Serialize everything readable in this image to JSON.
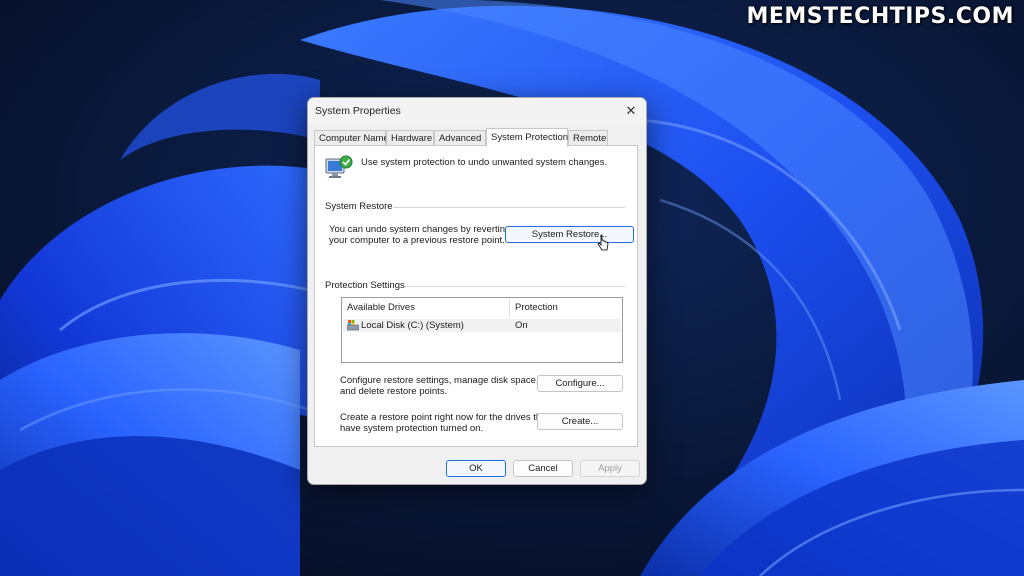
{
  "watermark": "MEMSTECHTIPS.COM",
  "dialog": {
    "title": "System Properties",
    "tabs": [
      {
        "label": "Computer Name",
        "active": false
      },
      {
        "label": "Hardware",
        "active": false
      },
      {
        "label": "Advanced",
        "active": false
      },
      {
        "label": "System Protection",
        "active": true
      },
      {
        "label": "Remote",
        "active": false
      }
    ],
    "intro_text": "Use system protection to undo unwanted system changes.",
    "system_restore": {
      "group_label": "System Restore",
      "description_line1": "You can undo system changes by reverting",
      "description_line2": "your computer to a previous restore point.",
      "button_label": "System Restore..."
    },
    "protection_settings": {
      "group_label": "Protection Settings",
      "columns": [
        "Available Drives",
        "Protection"
      ],
      "drives": [
        {
          "name": "Local Disk (C:) (System)",
          "protection": "On"
        }
      ],
      "configure_text_line1": "Configure restore settings, manage disk space,",
      "configure_text_line2": "and delete restore points.",
      "configure_button": "Configure...",
      "create_text_line1": "Create a restore point right now for the drives that",
      "create_text_line2": "have system protection turned on.",
      "create_button": "Create..."
    },
    "footer": {
      "ok": "OK",
      "cancel": "Cancel",
      "apply": "Apply"
    }
  },
  "colors": {
    "accent": "#1e6fd9",
    "wallpaper_dark": "#08142e",
    "wallpaper_blue": "#1a4cff"
  }
}
